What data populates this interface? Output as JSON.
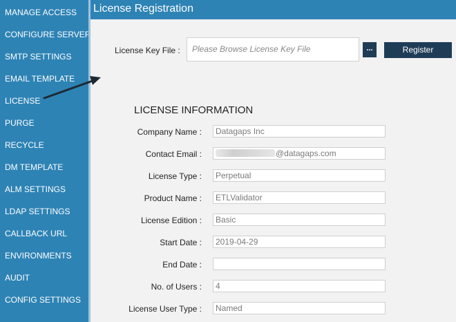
{
  "sidebar": {
    "items": [
      {
        "label": "MANAGE ACCESS"
      },
      {
        "label": "CONFIGURE SERVER"
      },
      {
        "label": "SMTP SETTINGS"
      },
      {
        "label": "EMAIL TEMPLATE"
      },
      {
        "label": "LICENSE"
      },
      {
        "label": "PURGE"
      },
      {
        "label": "RECYCLE"
      },
      {
        "label": "DM TEMPLATE"
      },
      {
        "label": "ALM SETTINGS"
      },
      {
        "label": "LDAP SETTINGS"
      },
      {
        "label": "CALLBACK URL"
      },
      {
        "label": "ENVIRONMENTS"
      },
      {
        "label": "AUDIT"
      },
      {
        "label": "CONFIG SETTINGS"
      }
    ]
  },
  "header": {
    "title": "License Registration"
  },
  "registration": {
    "key_label": "License Key File :",
    "key_placeholder": "Please Browse License Key File",
    "browse_label": "...",
    "register_label": "Register"
  },
  "info": {
    "title": "LICENSE INFORMATION",
    "fields": [
      {
        "label": "Company Name :",
        "value": "Datagaps Inc"
      },
      {
        "label": "Contact Email :",
        "value": "@datagaps.com"
      },
      {
        "label": "License Type :",
        "value": "Perpetual"
      },
      {
        "label": "Product Name :",
        "value": "ETLValidator"
      },
      {
        "label": "License Edition :",
        "value": "Basic"
      },
      {
        "label": "Start Date :",
        "value": "2019-04-29"
      },
      {
        "label": "End Date :",
        "value": ""
      },
      {
        "label": "No. of Users :",
        "value": "4"
      },
      {
        "label": "License User Type :",
        "value": "Named"
      }
    ]
  },
  "colors": {
    "sidebar_bg": "#2e83b5",
    "header_bg": "#2e83b5",
    "button_bg": "#1f3c57",
    "content_bg": "#f2f2f2"
  }
}
